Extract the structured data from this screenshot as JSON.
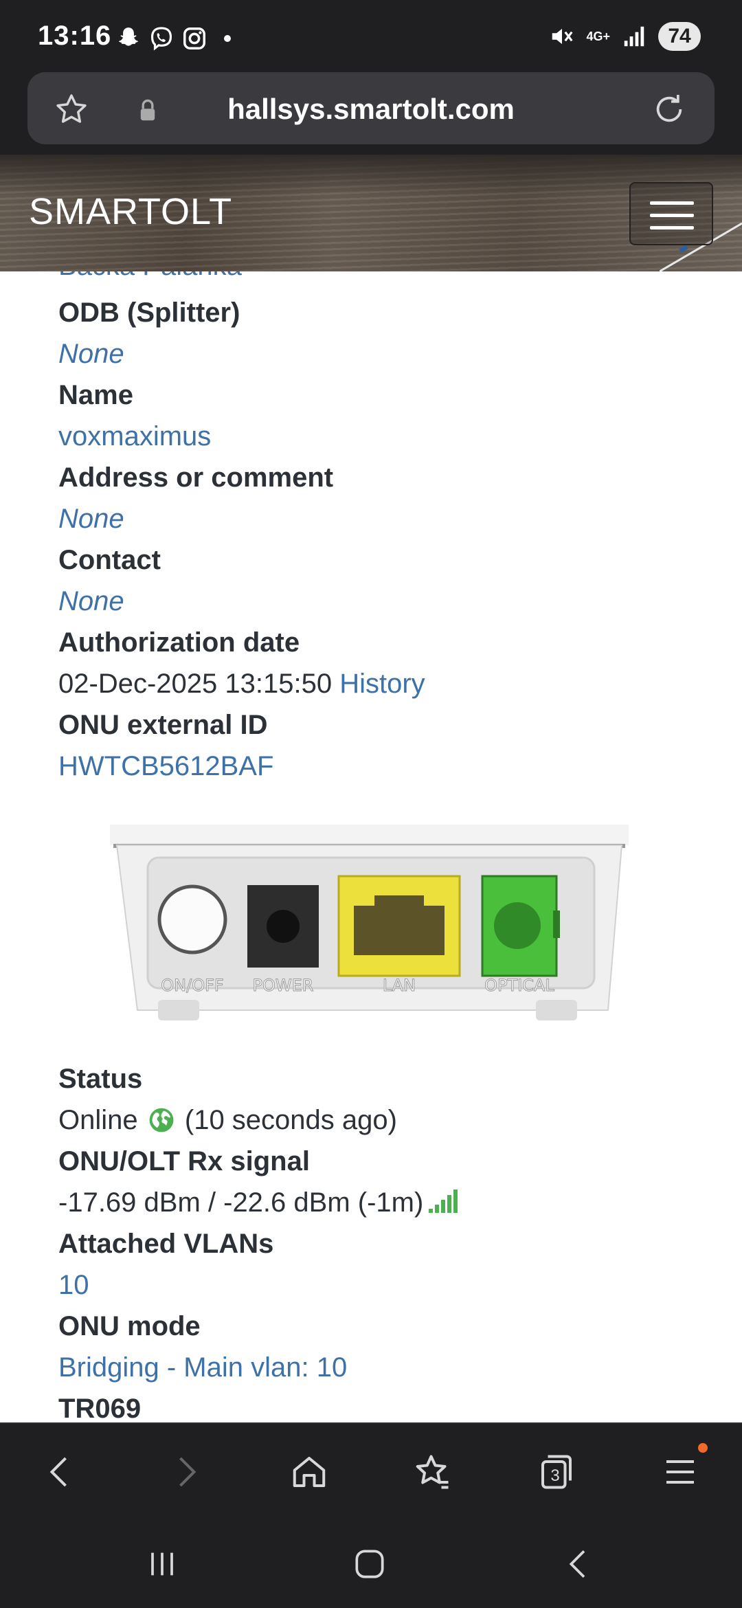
{
  "status_bar": {
    "time": "13:16",
    "network": "4G+",
    "battery": "74",
    "icons": [
      "snapchat-icon",
      "viber-icon",
      "instagram-icon",
      "mute-icon",
      "signal-icon"
    ]
  },
  "browser": {
    "url": "hallsys.smartolt.com",
    "tab_count": "3"
  },
  "site": {
    "brand": "SMARTOLT"
  },
  "onu": {
    "cropped_value": "Backa Palanka",
    "odb_label": "ODB (Splitter)",
    "odb_value": "None",
    "name_label": "Name",
    "name_value": "voxmaximus",
    "address_label": "Address or comment",
    "address_value": "None",
    "contact_label": "Contact",
    "contact_value": "None",
    "auth_label": "Authorization date",
    "auth_value": "02-Dec-2025 13:15:50",
    "history_link": "History",
    "external_id_label": "ONU external ID",
    "external_id_value": "HWTCB5612BAF",
    "device_ports": [
      "ON/OFF",
      "POWER",
      "LAN",
      "OPTICAL"
    ],
    "status_label": "Status",
    "status_value": "Online",
    "status_time": "(10 seconds ago)",
    "rx_label": "ONU/OLT Rx signal",
    "rx_value": "-17.69 dBm / -22.6 dBm (-1m)",
    "vlans_label": "Attached VLANs",
    "vlans_value": "10",
    "mode_label": "ONU mode",
    "mode_value": "Bridging - Main vlan: 10",
    "tr069_label": "TR069"
  },
  "colors": {
    "link": "#3d71a8",
    "text": "#2c3138",
    "online_green": "#4caf50"
  }
}
